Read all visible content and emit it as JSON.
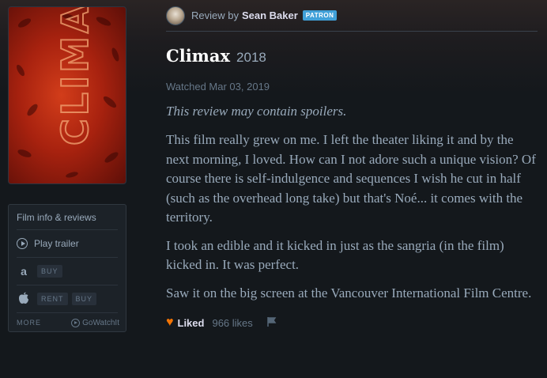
{
  "poster": {
    "lettering": "CLIMAX"
  },
  "sidebar": {
    "film_info_label": "Film info & reviews",
    "play_trailer_label": "Play trailer",
    "amazon": {
      "icon": "amazon-icon",
      "glyph": "a",
      "buy_label": "BUY"
    },
    "apple": {
      "icon": "apple-icon",
      "rent_label": "RENT",
      "buy_label": "BUY"
    },
    "more_label": "MORE",
    "gowatchit_label": "GoWatchIt"
  },
  "review": {
    "prefix": "Review by",
    "reviewer": "Sean Baker",
    "badge": "PATRON",
    "film_title": "Climax",
    "film_year": "2018",
    "watched": "Watched Mar 03, 2019",
    "spoiler_notice": "This review may contain spoilers.",
    "paragraphs": [
      "This film really grew on me. I left the theater liking it and by the next morning, I loved. How can I not adore such a unique vision? Of course there is self-indulgence and sequences I wish he cut in half (such as the overhead long take) but that's Noé... it comes with the territory.",
      "I took an edible and it kicked in just as the sangria (in the film) kicked in. It was perfect.",
      "Saw it on the big screen at the Vancouver International Film Centre."
    ],
    "liked_label": "Liked",
    "likes_count": "966 likes"
  },
  "colors": {
    "accent_orange": "#f27405",
    "patron_blue": "#40a0d8",
    "background": "#14181c"
  }
}
